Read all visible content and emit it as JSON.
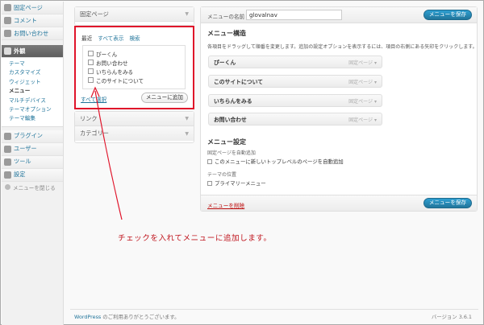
{
  "sidebar": {
    "top_items": [
      {
        "label": "固定ページ",
        "icon": "page-icon"
      },
      {
        "label": "コメント",
        "icon": "comment-icon"
      },
      {
        "label": "お問い合わせ",
        "icon": "contact-icon"
      }
    ],
    "active": {
      "label": "外観",
      "icon": "appearance-icon"
    },
    "submenu": [
      "テーマ",
      "カスタマイズ",
      "ウィジェット",
      "メニュー",
      "マルチデバイス",
      "テーマオプション",
      "テーマ編集"
    ],
    "submenu_current": "メニュー",
    "bottom_items": [
      {
        "label": "プラグイン",
        "icon": "plugin-icon"
      },
      {
        "label": "ユーザー",
        "icon": "user-icon"
      },
      {
        "label": "ツール",
        "icon": "tool-icon"
      },
      {
        "label": "設定",
        "icon": "settings-icon"
      }
    ],
    "collapse": "メニューを閉じる"
  },
  "left": {
    "pages_box_title": "固定ページ",
    "tabs": [
      "最近",
      "すべて表示",
      "検索"
    ],
    "selected_tab": "最近",
    "pages": [
      "ぴーくん",
      "お問い合わせ",
      "いちらんをみる",
      "このサイトについて"
    ],
    "select_all": "すべて選択",
    "add_button": "メニューに追加",
    "links_box_title": "リンク",
    "categories_box_title": "カテゴリー"
  },
  "menu": {
    "name_label": "メニューの名前",
    "name_value": "glovalnav",
    "save_button": "メニューを保存",
    "structure_title": "メニュー構造",
    "instructions": "各項目をドラッグして順番を変更します。追加の設定オプションを表示するには、項目の右側にある矢印をクリックします。",
    "items": [
      {
        "title": "ぴーくん",
        "type": "固定ページ"
      },
      {
        "title": "このサイトについて",
        "type": "固定ページ"
      },
      {
        "title": "いちらんをみる",
        "type": "固定ページ"
      },
      {
        "title": "お問い合わせ",
        "type": "固定ページ"
      }
    ],
    "settings_title": "メニュー設定",
    "auto_add_label": "固定ページを自動追加",
    "auto_add_option": "このメニューに新しいトップレベルのページを自動追加",
    "location_label": "テーマの位置",
    "location_option": "プライマリーメニュー",
    "delete_link": "メニューを削除",
    "save_button_bottom": "メニューを保存"
  },
  "annotation": {
    "text": "チェックを入れてメニューに追加します。",
    "color": "#c0161f"
  },
  "footer": {
    "left_link": "WordPress",
    "left_text": " のご利用ありがとうございます。",
    "version": "バージョン 3.6.1"
  },
  "colors": {
    "accent": "#21759b",
    "highlight_box": "#e0142a"
  }
}
